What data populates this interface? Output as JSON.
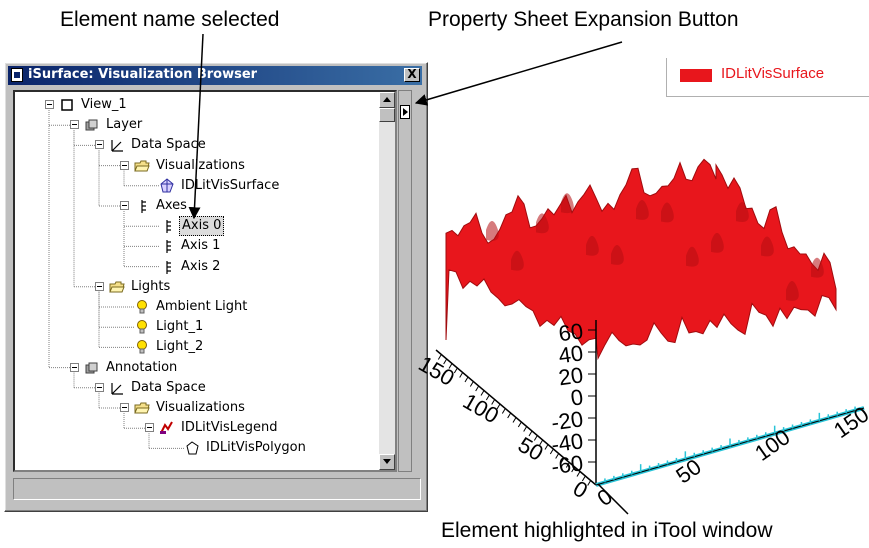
{
  "callouts": {
    "element_name": "Element name selected",
    "expansion_button": "Property Sheet Expansion Button",
    "highlighted": "Element highlighted in iTool window"
  },
  "window": {
    "title": "iSurface: Visualization Browser",
    "close_label": "X"
  },
  "tree": [
    {
      "label": "View_1",
      "icon": "view-icon",
      "depth": 0
    },
    {
      "label": "Layer",
      "icon": "layer-icon",
      "depth": 1
    },
    {
      "label": "Data Space",
      "icon": "dataspace-icon",
      "depth": 2
    },
    {
      "label": "Visualizations",
      "icon": "folder-icon",
      "depth": 3
    },
    {
      "label": "IDLitVisSurface",
      "icon": "surface-icon",
      "depth": 4
    },
    {
      "label": "Axes",
      "icon": "axes-icon",
      "depth": 3
    },
    {
      "label": "Axis 0",
      "icon": "axis-icon",
      "depth": 4,
      "selected": true
    },
    {
      "label": "Axis 1",
      "icon": "axis-icon",
      "depth": 4
    },
    {
      "label": "Axis 2",
      "icon": "axis-icon",
      "depth": 4
    },
    {
      "label": "Lights",
      "icon": "folder-icon",
      "depth": 2
    },
    {
      "label": "Ambient Light",
      "icon": "lightbulb-icon",
      "depth": 3
    },
    {
      "label": "Light_1",
      "icon": "lightbulb-icon",
      "depth": 3
    },
    {
      "label": "Light_2",
      "icon": "lightbulb-icon",
      "depth": 3
    },
    {
      "label": "Annotation",
      "icon": "layer-icon",
      "depth": 1
    },
    {
      "label": "Data Space",
      "icon": "dataspace-icon",
      "depth": 2
    },
    {
      "label": "Visualizations",
      "icon": "folder-icon",
      "depth": 3
    },
    {
      "label": "IDLitVisLegend",
      "icon": "legend-icon",
      "depth": 4
    },
    {
      "label": "IDLitVisPolygon",
      "icon": "polygon-icon",
      "depth": 5
    }
  ],
  "legend": {
    "label": "IDLitVisSurface",
    "color": "#e8161c"
  },
  "plot": {
    "surface_color": "#e8161c",
    "highlight_color": "#29c4d8",
    "z_ticks": [
      "60",
      "40",
      "20",
      "0",
      "-20",
      "-40",
      "-60"
    ],
    "x_ticks": [
      "0",
      "50",
      "100",
      "150"
    ],
    "y_ticks": [
      "0",
      "50",
      "100",
      "150"
    ]
  }
}
